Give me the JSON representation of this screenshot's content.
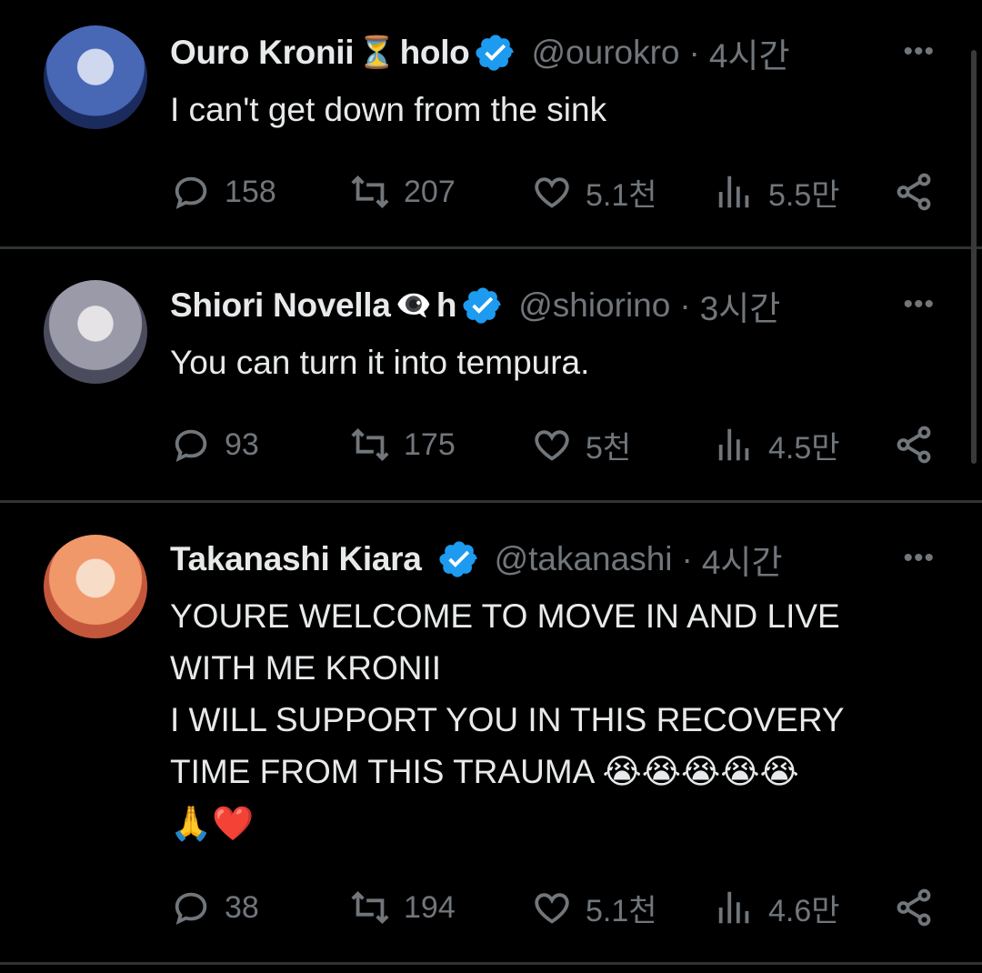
{
  "tweets": [
    {
      "name": "Ouro Kronii",
      "name_suffix": "holo",
      "badge_emoji": "⏳",
      "handle": "@ourokro",
      "time": "4시간",
      "text": "I can't get down from the sink",
      "replies": "158",
      "retweets": "207",
      "likes": "5.1천",
      "views": "5.5만",
      "avatar_color": "#3a5ba8"
    },
    {
      "name": "Shiori Novella",
      "name_suffix": "h",
      "badge_emoji": "👁️‍🗨️",
      "handle": "@shiorino",
      "time": "3시간",
      "text": "You can turn it into tempura.",
      "replies": "93",
      "retweets": "175",
      "likes": "5천",
      "views": "4.5만",
      "avatar_color": "#8d8f9c"
    },
    {
      "name": "Takanashi Kiara",
      "name_suffix": "",
      "badge_emoji": "",
      "handle": "@takanashi",
      "time": "4시간",
      "text": "YOURE WELCOME TO MOVE IN AND LIVE\nWITH ME KRONII\nI WILL SUPPORT YOU IN THIS RECOVERY\nTIME FROM THIS TRAUMA 😭😭😭😭😭\n🙏❤️",
      "replies": "38",
      "retweets": "194",
      "likes": "5.1천",
      "views": "4.6만",
      "avatar_color": "#e8925a"
    }
  ],
  "more_label": "•••",
  "dot": "·",
  "colors": {
    "verified": "#1d9bf0",
    "muted": "#71767b",
    "text": "#e7e9ea",
    "divider": "#2f3336"
  }
}
